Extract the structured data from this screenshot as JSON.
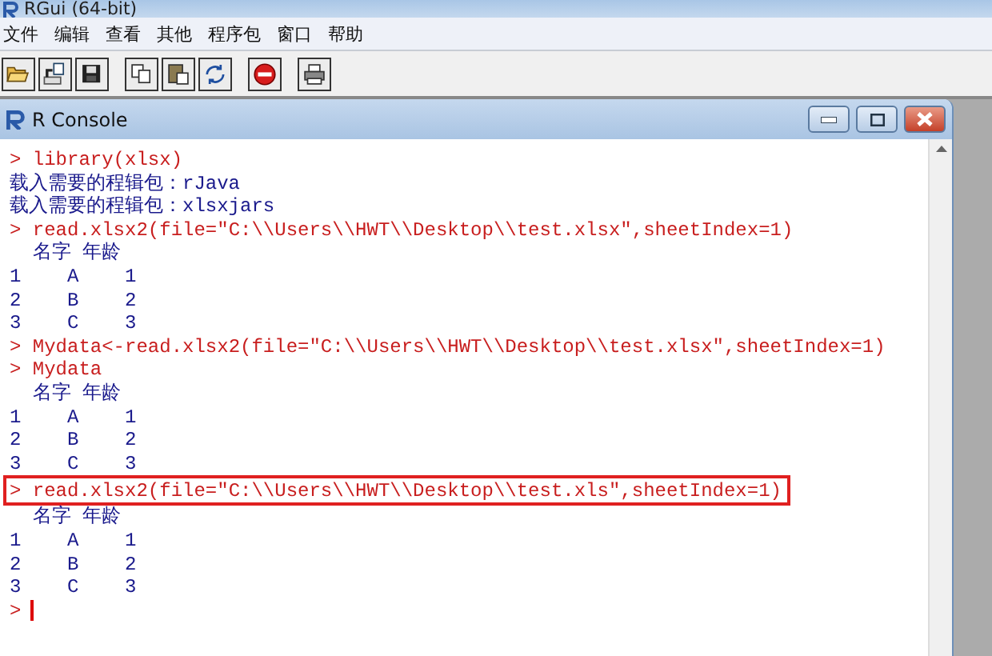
{
  "window": {
    "title": "RGui (64-bit)"
  },
  "menu": [
    "文件",
    "编辑",
    "查看",
    "其他",
    "程序包",
    "窗口",
    "帮助"
  ],
  "console": {
    "title": "R Console",
    "lines": [
      {
        "kind": "input",
        "prompt": ">",
        "text": "library(xlsx)",
        "highlighted": false
      },
      {
        "kind": "output",
        "text": "载入需要的程辑包：rJava"
      },
      {
        "kind": "output",
        "text": "载入需要的程辑包：xlsxjars"
      },
      {
        "kind": "input",
        "prompt": ">",
        "text": "read.xlsx2(file=\"C:\\\\Users\\\\HWT\\\\Desktop\\\\test.xlsx\",sheetIndex=1)",
        "highlighted": false
      },
      {
        "kind": "output",
        "text": "  名字 年龄"
      },
      {
        "kind": "output",
        "text": "1    A    1"
      },
      {
        "kind": "output",
        "text": "2    B    2"
      },
      {
        "kind": "output",
        "text": "3    C    3"
      },
      {
        "kind": "input",
        "prompt": ">",
        "text": "Mydata<-read.xlsx2(file=\"C:\\\\Users\\\\HWT\\\\Desktop\\\\test.xlsx\",sheetIndex=1)",
        "highlighted": false
      },
      {
        "kind": "input",
        "prompt": ">",
        "text": "Mydata",
        "highlighted": false
      },
      {
        "kind": "output",
        "text": "  名字 年龄"
      },
      {
        "kind": "output",
        "text": "1    A    1"
      },
      {
        "kind": "output",
        "text": "2    B    2"
      },
      {
        "kind": "output",
        "text": "3    C    3"
      },
      {
        "kind": "input",
        "prompt": ">",
        "text": "read.xlsx2(file=\"C:\\\\Users\\\\HWT\\\\Desktop\\\\test.xls\",sheetIndex=1)",
        "highlighted": true
      },
      {
        "kind": "output",
        "text": "  名字 年龄"
      },
      {
        "kind": "output",
        "text": "1    A    1"
      },
      {
        "kind": "output",
        "text": "2    B    2"
      },
      {
        "kind": "output",
        "text": "3    C    3"
      },
      {
        "kind": "prompt",
        "prompt": ">"
      }
    ]
  }
}
